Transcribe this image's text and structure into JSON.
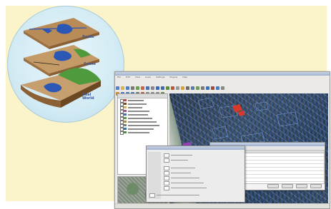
{
  "concept": {
    "layer_labels": [
      "Route",
      "Scene",
      "Real World"
    ]
  },
  "app": {
    "title": "",
    "menu_items": [
      "File",
      "Edit",
      "View",
      "Layer",
      "Settings",
      "Plugins",
      "Help"
    ]
  },
  "colors": {
    "background": "#fbf4ca",
    "map_dark": "#2f3b47",
    "map_blue": "#3c6ec8",
    "highlight_red": "#d8392b",
    "highlight_purple": "#8e44ad"
  }
}
